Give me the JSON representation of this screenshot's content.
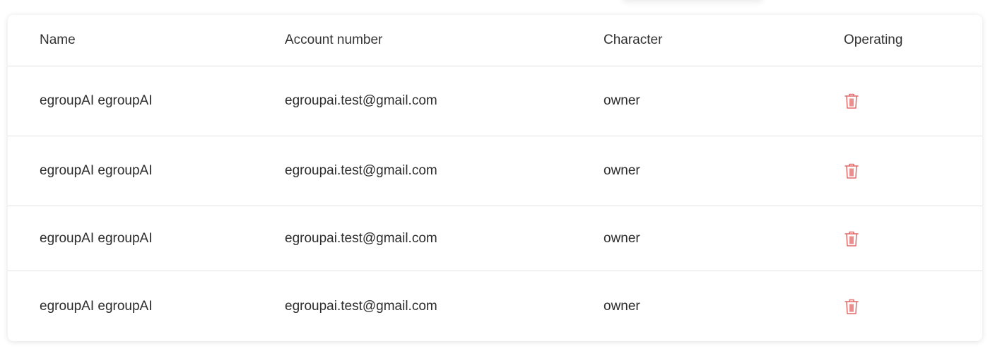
{
  "table": {
    "columns": [
      "Name",
      "Account number",
      "Character",
      "Operating"
    ],
    "rows": [
      {
        "name": "egroupAI egroupAI",
        "account": "egroupai.test@gmail.com",
        "character": "owner",
        "action_icon": "trash-icon"
      },
      {
        "name": "egroupAI egroupAI",
        "account": "egroupai.test@gmail.com",
        "character": "owner",
        "action_icon": "trash-icon"
      },
      {
        "name": "egroupAI egroupAI",
        "account": "egroupai.test@gmail.com",
        "character": "owner",
        "action_icon": "trash-icon"
      },
      {
        "name": "egroupAI egroupAI",
        "account": "egroupai.test@gmail.com",
        "character": "owner",
        "action_icon": "trash-icon"
      }
    ]
  },
  "colors": {
    "delete": "#e26a6a",
    "divider": "#e3e3e3",
    "text": "#2d2d2d"
  }
}
